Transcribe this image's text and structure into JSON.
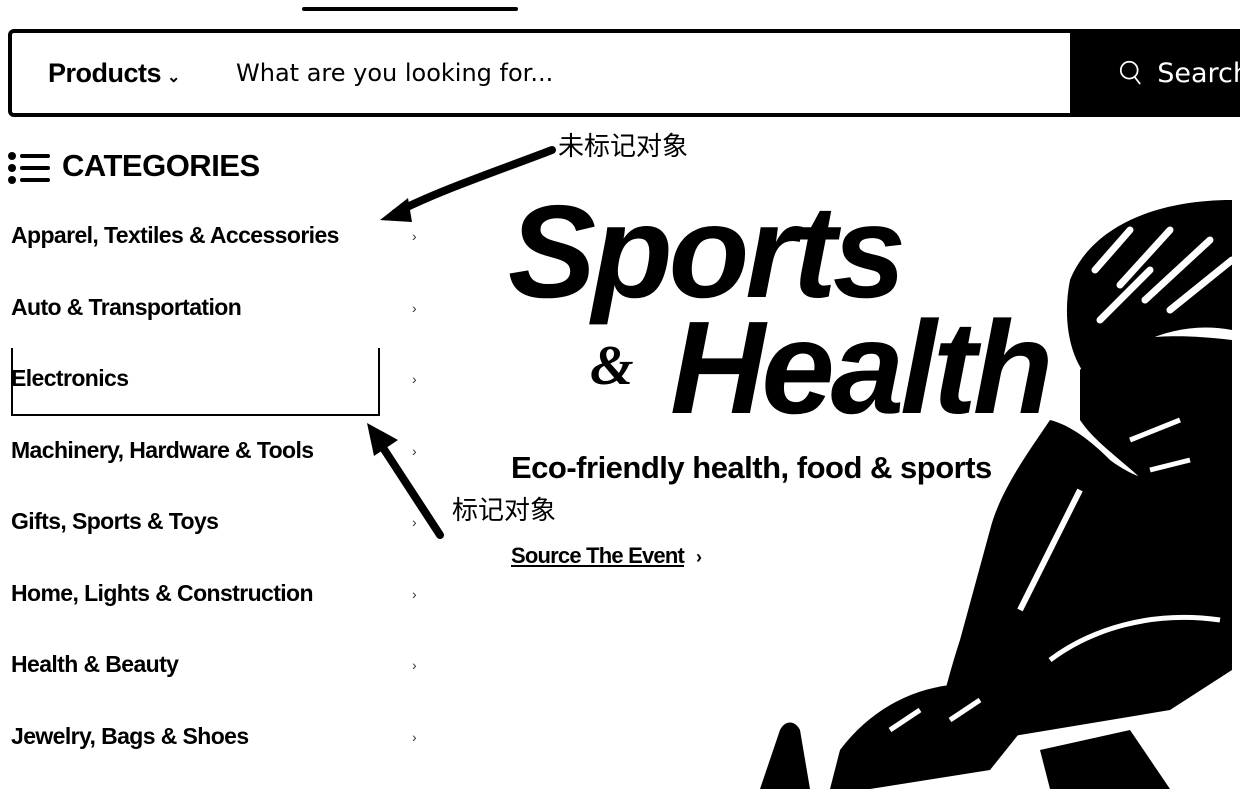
{
  "header": {
    "products_dropdown": "Products",
    "search_placeholder": "What are you looking for...",
    "search_button": "Search"
  },
  "sidebar": {
    "title": "CATEGORIES",
    "items": [
      {
        "label": "Apparel, Textiles & Accessories",
        "marked": false
      },
      {
        "label": "Auto & Transportation",
        "marked": false
      },
      {
        "label": "Electronics",
        "marked": true
      },
      {
        "label": "Machinery, Hardware & Tools",
        "marked": false
      },
      {
        "label": "Gifts, Sports & Toys",
        "marked": false
      },
      {
        "label": "Home, Lights & Construction",
        "marked": false
      },
      {
        "label": "Health & Beauty",
        "marked": false
      },
      {
        "label": "Jewelry, Bags & Shoes",
        "marked": false
      }
    ]
  },
  "banner": {
    "title_line1": "Sports",
    "title_amp": "&",
    "title_line2": "Health",
    "subtitle": "Eco-friendly health, food & sports",
    "link_label": "Source The Event",
    "link_chevron": "›"
  },
  "annotations": {
    "unmarked_label": "未标记对象",
    "marked_label": "标记对象"
  }
}
